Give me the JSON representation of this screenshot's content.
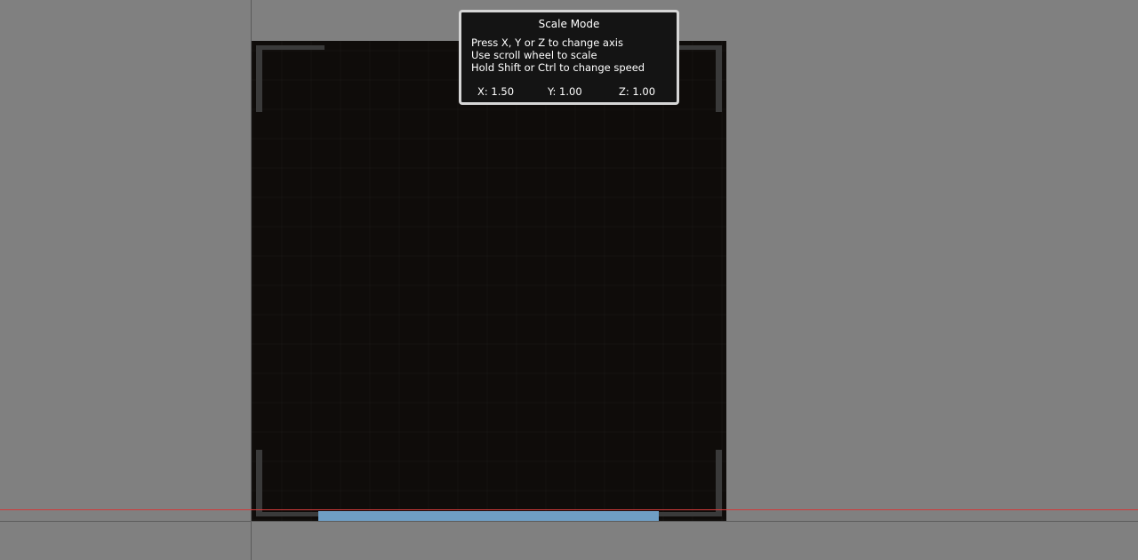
{
  "scale_mode": {
    "title": "Scale Mode",
    "instructions": [
      "Press X, Y or Z to change axis",
      "Use scroll wheel to scale",
      "Hold Shift or Ctrl to change speed"
    ],
    "axes": {
      "x": "X: 1.50",
      "y": "Y: 1.00",
      "z": "Z: 1.00"
    }
  },
  "colors": {
    "background": "#808080",
    "object": "#0f0c0a",
    "x_axis_line": "#d23a3a",
    "selection_bar": "#6f9ec4",
    "panel_bg": "#141414",
    "panel_border": "#d6d6d6"
  }
}
